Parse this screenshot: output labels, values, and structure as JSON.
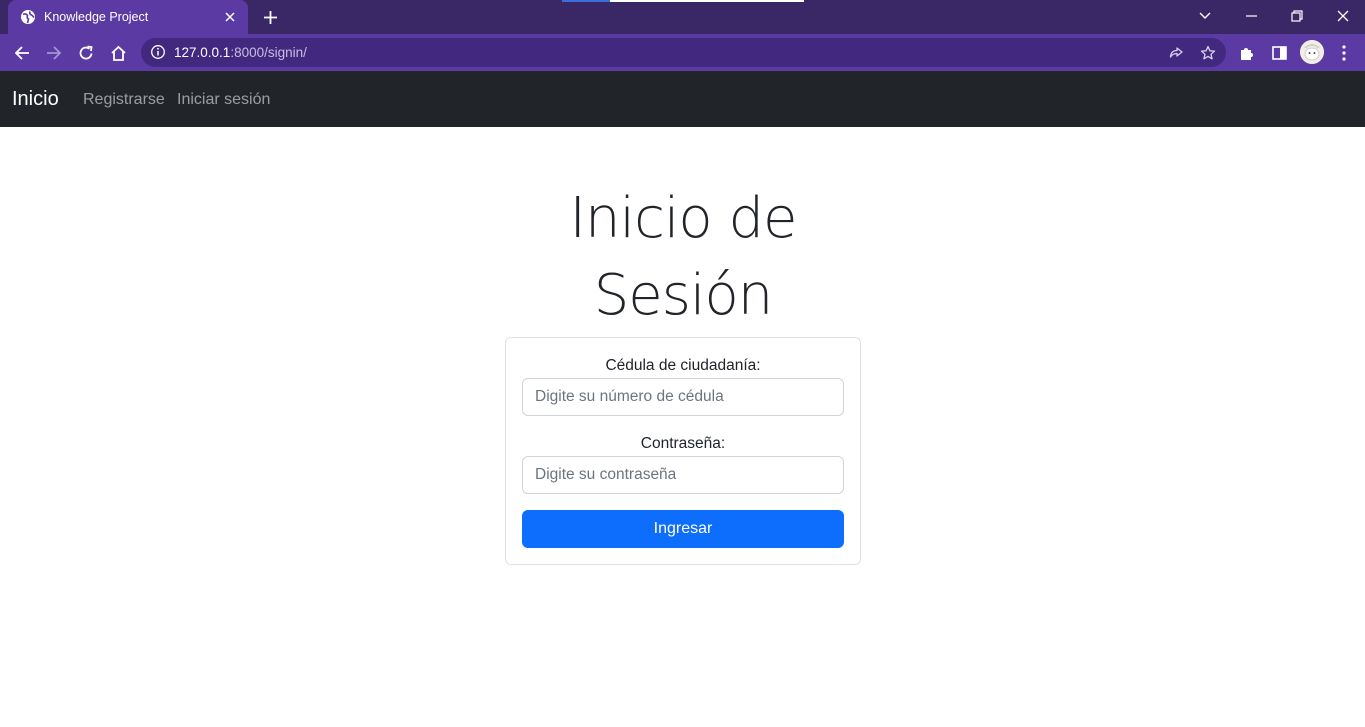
{
  "browser": {
    "tab_title": "Knowledge Project",
    "url_host": "127.0.0.1",
    "url_path": ":8000/signin/",
    "colors": {
      "frame": "#3a2866",
      "toolbar": "#5b3ba3",
      "omnibox": "#43287f"
    }
  },
  "navbar": {
    "brand": "Inicio",
    "links": [
      "Registrarse",
      "Iniciar sesión"
    ],
    "background": "#212529"
  },
  "page": {
    "title_line1": "Inicio de",
    "title_line2": "Sesión"
  },
  "form": {
    "id_label": "Cédula de ciudadanía:",
    "id_placeholder": "Digite su número de cédula",
    "password_label": "Contraseña:",
    "password_placeholder": "Digite su contraseña",
    "submit_label": "Ingresar",
    "accent_color": "#0d6efd"
  }
}
